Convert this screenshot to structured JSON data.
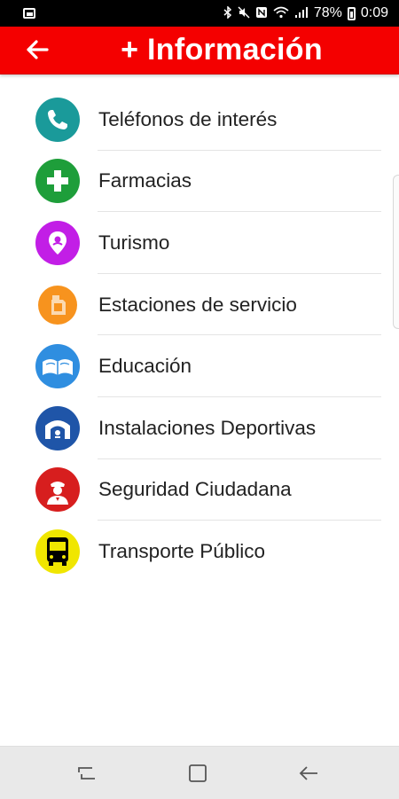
{
  "status_bar": {
    "battery_percent": "78%",
    "time": "0:09",
    "icons": [
      "image-icon",
      "bluetooth-icon",
      "mute-icon",
      "nfc-icon",
      "wifi-icon",
      "signal-icon",
      "battery-icon"
    ]
  },
  "app_bar": {
    "title": "+ Información",
    "back_icon": "arrow-left-icon",
    "color": "#f40000"
  },
  "menu": {
    "items": [
      {
        "label": "Teléfonos de interés",
        "icon": "phone-icon",
        "color": "#1a9a9a"
      },
      {
        "label": "Farmacias",
        "icon": "pharmacy-cross-icon",
        "color": "#1e9e3a"
      },
      {
        "label": "Turismo",
        "icon": "location-pin-icon",
        "color": "#c21ee6"
      },
      {
        "label": "Estaciones de servicio",
        "icon": "fuel-can-icon",
        "color": "#f7931e"
      },
      {
        "label": "Educación",
        "icon": "open-book-icon",
        "color": "#2f8ee0"
      },
      {
        "label": "Instalaciones Deportivas",
        "icon": "stadium-icon",
        "color": "#1f55a8"
      },
      {
        "label": "Seguridad Ciudadana",
        "icon": "police-officer-icon",
        "color": "#d71e1e"
      },
      {
        "label": "Transporte Público",
        "icon": "bus-icon",
        "color": "#f0e600"
      }
    ]
  },
  "nav_bar": {
    "buttons": [
      "recent-apps-icon",
      "home-icon",
      "back-icon"
    ]
  }
}
